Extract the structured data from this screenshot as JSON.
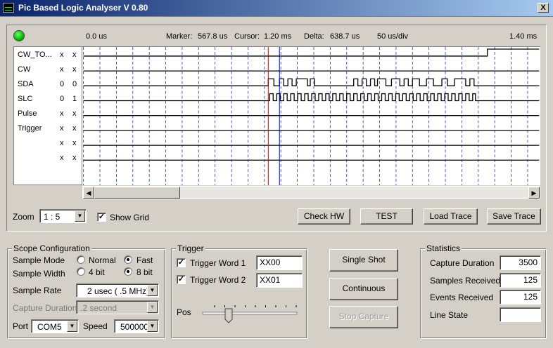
{
  "window": {
    "title": "Pic Based Logic Analyser V 0.80",
    "close_label": "X"
  },
  "info": {
    "start_time": "0.0 us",
    "marker_label": "Marker:",
    "marker_value": "567.8 us",
    "cursor_label": "Cursor:",
    "cursor_value": "1.20 ms",
    "delta_label": "Delta:",
    "delta_value": "638.7 us",
    "scale": "50 us/div",
    "end_time": "1.40 ms"
  },
  "channels": [
    {
      "name": "CW_TO...",
      "v1": "x",
      "v2": "x"
    },
    {
      "name": "CW",
      "v1": "x",
      "v2": "x"
    },
    {
      "name": "SDA",
      "v1": "0",
      "v2": "0"
    },
    {
      "name": "SLC",
      "v1": "0",
      "v2": "1"
    },
    {
      "name": "Pulse",
      "v1": "x",
      "v2": "x"
    },
    {
      "name": "Trigger",
      "v1": "x",
      "v2": "x"
    },
    {
      "name": "",
      "v1": "x",
      "v2": "x"
    },
    {
      "name": "",
      "v1": "x",
      "v2": "x"
    }
  ],
  "zoom": {
    "label": "Zoom",
    "value": "1 : 5"
  },
  "show_grid": {
    "label": "Show Grid",
    "checked": true
  },
  "buttons": {
    "check_hw": "Check HW",
    "test": "TEST",
    "load_trace": "Load Trace",
    "save_trace": "Save Trace"
  },
  "scope": {
    "title": "Scope Configuration",
    "sample_mode_label": "Sample Mode",
    "mode_normal": "Normal",
    "mode_fast": "Fast",
    "mode_selected": "Fast",
    "sample_width_label": "Sample Width",
    "width_4": "4 bit",
    "width_8": "8 bit",
    "width_selected": "8 bit",
    "sample_rate_label": "Sample Rate",
    "sample_rate": "2 usec ( .5 MHz)",
    "capture_duration_label": "Capture Duration",
    "capture_duration": ".2 second",
    "port_label": "Port",
    "port": "COM5",
    "speed_label": "Speed",
    "speed": "500000"
  },
  "trigger": {
    "title": "Trigger",
    "word1_label": "Trigger Word 1",
    "word1_checked": true,
    "word1_value": "XX00",
    "word2_label": "Trigger Word 2",
    "word2_checked": true,
    "word2_value": "XX01",
    "pos_label": "Pos"
  },
  "actions": {
    "single_shot": "Single Shot",
    "continuous": "Continuous",
    "stop_capture": "Stop Capture"
  },
  "statistics": {
    "title": "Statistics",
    "capture_duration_label": "Capture Duration",
    "capture_duration": "3500",
    "samples_received_label": "Samples Received",
    "samples_received": "125",
    "events_received_label": "Events Received",
    "events_received": "125",
    "line_state_label": "Line State",
    "line_state": ""
  },
  "colors": {
    "led": "#00c000",
    "marker": "#ff0000",
    "cursor": "#0000ff",
    "grid": "#0000c0"
  }
}
